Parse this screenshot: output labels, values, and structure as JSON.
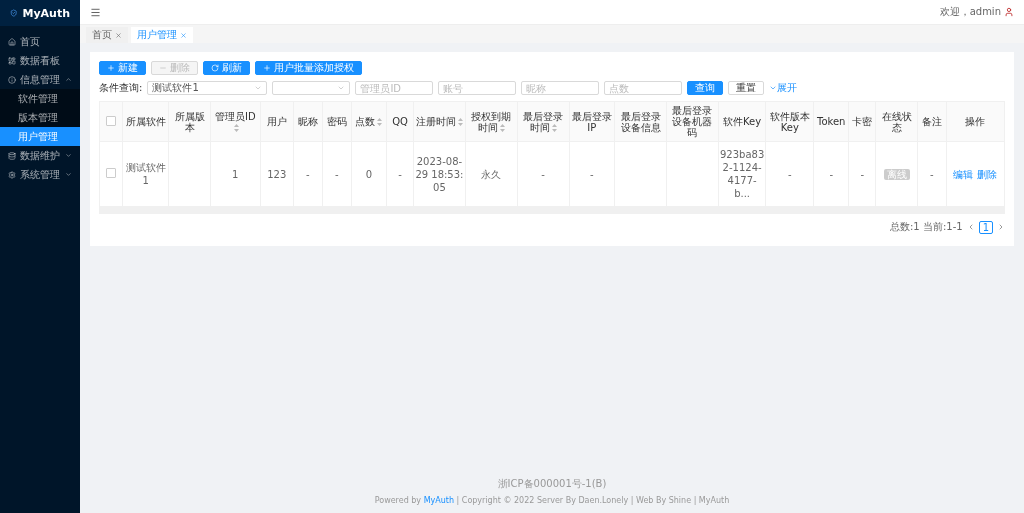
{
  "brand": {
    "name": "MyAuth"
  },
  "sidebar": {
    "items": [
      {
        "label": "首页",
        "selected": false
      },
      {
        "label": "数据看板",
        "selected": false
      },
      {
        "label": "信息管理",
        "expanded": true,
        "selected": false,
        "children": [
          {
            "label": "软件管理",
            "selected": false
          },
          {
            "label": "版本管理",
            "selected": false
          },
          {
            "label": "用户管理",
            "selected": true
          }
        ]
      },
      {
        "label": "数据维护",
        "expanded": false,
        "selected": false
      },
      {
        "label": "系统管理",
        "expanded": false,
        "selected": false
      }
    ]
  },
  "header": {
    "welcome": "欢迎，admin"
  },
  "tabs": [
    {
      "label": "首页",
      "selected": false
    },
    {
      "label": "用户管理",
      "selected": true
    }
  ],
  "toolbar": [
    {
      "label": "新建",
      "disabled": false
    },
    {
      "label": "删除",
      "disabled": true
    },
    {
      "label": "刷新",
      "disabled": false
    },
    {
      "label": "用户批量添加授权",
      "disabled": false
    }
  ],
  "filter": {
    "label": "条件查询:",
    "fields": [
      {
        "kind": "select",
        "value": "测试软件1"
      },
      {
        "kind": "select"
      },
      {
        "kind": "input",
        "placeholder": "管理员ID"
      },
      {
        "kind": "input",
        "placeholder": "账号"
      },
      {
        "kind": "input",
        "placeholder": "昵称"
      },
      {
        "kind": "input",
        "placeholder": "点数"
      }
    ],
    "search": "查询",
    "reset": "重置",
    "expand": "展开"
  },
  "table": {
    "select_all_checked": false,
    "columns": [
      {
        "label": "所属软件",
        "sortable": false
      },
      {
        "label": "所属版本",
        "sortable": false
      },
      {
        "label": "管理员ID",
        "sortable": true
      },
      {
        "label": "用户",
        "sortable": false
      },
      {
        "label": "昵称",
        "sortable": false
      },
      {
        "label": "密码",
        "sortable": false
      },
      {
        "label": "点数",
        "sortable": true
      },
      {
        "label": "QQ",
        "sortable": false
      },
      {
        "label": "注册时间",
        "sortable": true
      },
      {
        "label": "授权到期时间",
        "sortable": true
      },
      {
        "label": "最后登录时间",
        "sortable": true
      },
      {
        "label": "最后登录IP",
        "sortable": false
      },
      {
        "label": "最后登录设备信息",
        "sortable": false
      },
      {
        "label": "最后登录设备机器码",
        "sortable": false
      },
      {
        "label": "软件Key",
        "sortable": false
      },
      {
        "label": "软件版本Key",
        "sortable": false
      },
      {
        "label": "Token",
        "sortable": false
      },
      {
        "label": "卡密",
        "sortable": false
      },
      {
        "label": "在线状态",
        "sortable": false
      },
      {
        "label": "备注",
        "sortable": false
      },
      {
        "label": "操作",
        "sortable": false
      }
    ],
    "rows": [
      {
        "checked": false,
        "cells": [
          "测试软件1",
          "",
          "1",
          "123",
          "-",
          "-",
          "0",
          "-",
          "2023-08-29 18:53:05",
          "永久",
          "-",
          "-",
          "",
          "",
          "923ba832-1124-4177-b...",
          "-",
          "-",
          "-",
          "离线",
          "-"
        ],
        "actions": [
          "编辑",
          "删除"
        ]
      }
    ]
  },
  "pagination": {
    "summary": "总数:1 当前:1-1",
    "pages": [
      {
        "label": "1",
        "selected": true
      }
    ]
  },
  "footer": {
    "icp": "浙ICP备000001号-1(B)",
    "credits": "Powered by ",
    "link": "MyAuth",
    "rest": " | Copyright © 2022 Server By Daen.Lonely | Web By Shine | MyAuth"
  }
}
